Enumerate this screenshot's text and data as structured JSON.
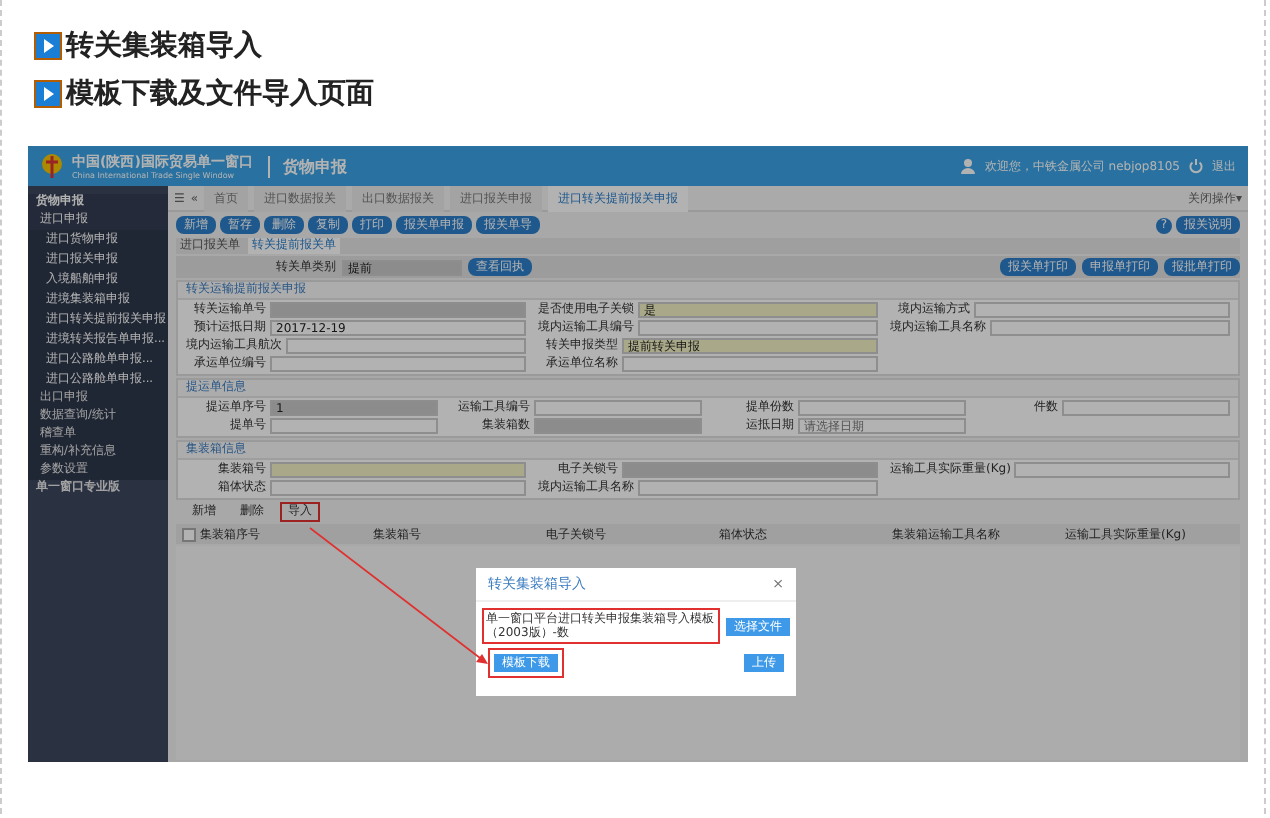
{
  "headings": [
    "转关集装箱导入",
    "模板下载及文件导入页面"
  ],
  "app": {
    "title": "中国(陕西)国际贸易单一窗口",
    "subtitle": "China International Trade Single Window",
    "module": "货物申报",
    "user": "欢迎您，中铁金属公司 nebjop8105",
    "logout": "退出"
  },
  "sidebar": [
    {
      "label": "货物申报",
      "expanded": true,
      "children": [
        {
          "label": "进口申报",
          "expanded": true,
          "children": [
            {
              "label": "进口货物申报"
            },
            {
              "label": "进口报关申报"
            },
            {
              "label": "入境船舶申报"
            },
            {
              "label": "进境集装箱申报"
            },
            {
              "label": "进口转关提前报关申报"
            },
            {
              "label": "进境转关报告单申报..."
            },
            {
              "label": "进口公路舱单申报..."
            },
            {
              "label": "进口公路舱单申报..."
            }
          ]
        },
        {
          "label": "出口申报",
          "expanded": false
        },
        {
          "label": "数据查询/统计",
          "expanded": false
        },
        {
          "label": "稽查单",
          "expanded": false
        },
        {
          "label": "重构/补充信息",
          "expanded": false
        },
        {
          "label": "参数设置",
          "expanded": false
        }
      ]
    },
    {
      "label": "单一窗口专业版",
      "expanded": false
    }
  ],
  "tab_controls": [
    "☰",
    "«"
  ],
  "tabs": [
    {
      "label": "首页",
      "selected": false
    },
    {
      "label": "进口数据报关",
      "selected": false
    },
    {
      "label": "出口数据报关",
      "selected": false
    },
    {
      "label": "进口报关申报",
      "selected": false
    },
    {
      "label": "进口转关提前报关申报",
      "selected": true
    }
  ],
  "tab_menu": "关闭操作▾",
  "toolbar": [
    "新增",
    "暂存",
    "删除",
    "复制",
    "打印",
    "报关单申报",
    "报关单导"
  ],
  "help_icon": "?",
  "help_button": "报关说明",
  "subtabs": [
    {
      "label": "进口报关单",
      "selected": false
    },
    {
      "label": "转关提前报关单",
      "selected": true
    }
  ],
  "category": {
    "label": "转关单类别",
    "value": "提前",
    "button": "查看回执"
  },
  "print_buttons": [
    "报关单打印",
    "申报单打印",
    "报批单打印"
  ],
  "sections": [
    {
      "title": "转关运输提前报关申报",
      "rows": [
        [
          {
            "label": "转关运输单号",
            "kind": "readonly"
          },
          {
            "label": "是否使用电子关锁",
            "value": "是",
            "kind": "required"
          },
          {
            "label": "境内运输方式",
            "kind": "plain"
          }
        ],
        [
          {
            "label": "预计运抵日期",
            "value": "2017-12-19",
            "kind": "plain"
          },
          {
            "label": "境内运输工具编号",
            "kind": "plain"
          },
          {
            "label": "境内运输工具名称",
            "kind": "plain"
          }
        ],
        [
          {
            "label": "境内运输工具航次",
            "kind": "plain"
          },
          {
            "label": "转关申报类型",
            "value": "提前转关申报",
            "kind": "required"
          }
        ],
        [
          {
            "label": "承运单位编号",
            "kind": "plain"
          },
          {
            "label": "承运单位名称",
            "kind": "plain"
          }
        ]
      ]
    },
    {
      "title": "提运单信息",
      "rows": [
        [
          {
            "label": "提运单序号",
            "value": "1",
            "kind": "readonly"
          },
          {
            "label": "运输工具编号",
            "kind": "plain"
          },
          {
            "label": "提单份数",
            "kind": "plain"
          },
          {
            "label": "件数",
            "kind": "plain"
          }
        ],
        [
          {
            "label": "提单号",
            "kind": "plain"
          },
          {
            "label": "集装箱数",
            "kind": "readonly"
          },
          {
            "label": "运抵日期",
            "placeholder": "请选择日期",
            "kind": "plain"
          }
        ]
      ]
    },
    {
      "title": "集装箱信息",
      "rows": [
        [
          {
            "label": "集装箱号",
            "kind": "required"
          },
          {
            "label": "电子关锁号",
            "kind": "readonly"
          },
          {
            "label": "运输工具实际重量(Kg)",
            "kind": "plain"
          }
        ],
        [
          {
            "label": "箱体状态",
            "kind": "plain"
          },
          {
            "label": "境内运输工具名称",
            "kind": "plain"
          }
        ]
      ]
    }
  ],
  "table": {
    "actions": [
      {
        "label": "新增",
        "highlighted": false
      },
      {
        "label": "删除",
        "highlighted": false
      },
      {
        "label": "导入",
        "highlighted": true
      }
    ],
    "select_all": {
      "checked": false
    },
    "columns": [
      "集装箱序号",
      "集装箱号",
      "电子关锁号",
      "箱体状态",
      "集装箱运输工具名称",
      "运输工具实际重量(Kg)"
    ]
  },
  "dialog": {
    "title": "转关集装箱导入",
    "close": "×",
    "file": "单一窗口平台进口转关申报集装箱导入模板（2003版）-数",
    "choose": "选择文件",
    "download": "模板下载",
    "upload": "上传"
  }
}
